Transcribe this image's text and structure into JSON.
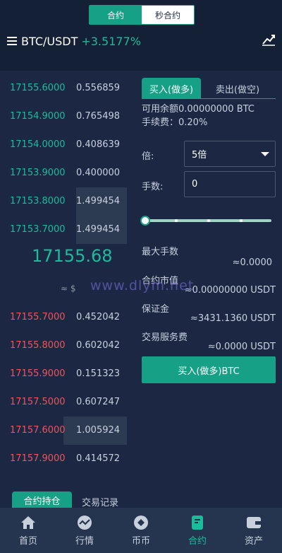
{
  "mode_tabs": [
    "合约",
    "秒合约"
  ],
  "header": {
    "pair": "BTC/USDT",
    "change": "+3.5177%"
  },
  "asks": [
    {
      "price": "17155.6000",
      "qty": "0.556859",
      "depth": 0
    },
    {
      "price": "17154.9000",
      "qty": "0.765498",
      "depth": 0
    },
    {
      "price": "17154.0000",
      "qty": "0.408639",
      "depth": 0
    },
    {
      "price": "17153.9000",
      "qty": "0.400000",
      "depth": 0
    },
    {
      "price": "17153.8000",
      "qty": "1.499454",
      "depth": 0.4
    },
    {
      "price": "17153.7000",
      "qty": "1.499454",
      "depth": 0.4
    }
  ],
  "last_price": "17155.68",
  "last_usd": "≈ $",
  "bids": [
    {
      "price": "17155.7000",
      "qty": "0.452042",
      "depth": 0
    },
    {
      "price": "17155.8000",
      "qty": "0.602042",
      "depth": 0
    },
    {
      "price": "17155.9000",
      "qty": "0.151323",
      "depth": 0
    },
    {
      "price": "17157.5000",
      "qty": "0.607247",
      "depth": 0
    },
    {
      "price": "17157.6000",
      "qty": "1.005924",
      "depth": 0.5
    },
    {
      "price": "17157.9000",
      "qty": "0.414572",
      "depth": 0
    }
  ],
  "trade": {
    "tab_buy": "买入(做多)",
    "tab_sell": "卖出(做空)",
    "available": "可用余额0.00000000 BTC",
    "fee": "手续费：0.20%",
    "leverage_label": "倍:",
    "leverage_value": "5倍",
    "lots_label": "手数:",
    "lots_value": "0",
    "slider_value": 0,
    "max_lots_label": "最大手数",
    "max_lots_value": "≈0.0000",
    "contract_value_label": "合约市值",
    "contract_value": "≈0.00000000 USDT",
    "margin_label": "保证金",
    "margin_value": "≈3431.1360 USDT",
    "service_fee_label": "交易服务费",
    "service_fee_value": "≈0.0000 USDT",
    "submit_label": "买入(做多)BTC"
  },
  "watermark": "www.dlym.net",
  "bottom_tabs": [
    "合约持仓",
    "交易记录"
  ],
  "nav": [
    {
      "label": "首页",
      "icon": "home-icon",
      "active": false
    },
    {
      "label": "行情",
      "icon": "market-icon",
      "active": false
    },
    {
      "label": "币币",
      "icon": "coin-icon",
      "active": false
    },
    {
      "label": "合约",
      "icon": "contract-icon",
      "active": true
    },
    {
      "label": "资产",
      "icon": "wallet-icon",
      "active": false
    }
  ],
  "colors": {
    "accent": "#16a085",
    "up": "#1abc9c",
    "down": "#f0545a",
    "background": "#1c2843"
  }
}
